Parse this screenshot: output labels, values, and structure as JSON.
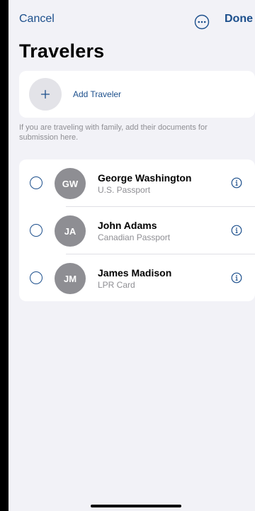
{
  "nav": {
    "cancel_label": "Cancel",
    "more_icon": "ellipsis-circle-icon",
    "done_label": "Done"
  },
  "title": "Travelers",
  "add_traveler": {
    "icon": "plus-icon",
    "label": "Add Traveler"
  },
  "hint": "If you are traveling with family, add their documents for submission here.",
  "travelers": [
    {
      "initials": "GW",
      "name": "George Washington",
      "document": "U.S. Passport",
      "selected": false
    },
    {
      "initials": "JA",
      "name": "John Adams",
      "document": "Canadian Passport",
      "selected": false
    },
    {
      "initials": "JM",
      "name": "James Madison",
      "document": "LPR Card",
      "selected": false
    }
  ],
  "colors": {
    "accent": "#1c4f8c",
    "background": "#f2f2f7",
    "avatar": "#8e8e93",
    "secondary_text": "#8e8e93"
  }
}
